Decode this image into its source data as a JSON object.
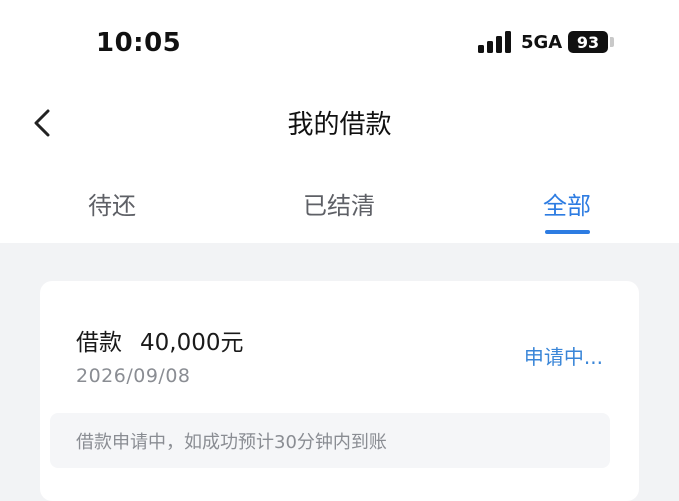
{
  "status_bar": {
    "time": "10:05",
    "network": "5GA",
    "battery": "93"
  },
  "header": {
    "title": "我的借款",
    "back_icon": "chevron-left-icon"
  },
  "tabs": [
    {
      "label": "待还"
    },
    {
      "label": "已结清"
    },
    {
      "label": "全部"
    }
  ],
  "active_tab": "全部",
  "loan": {
    "label": "借款",
    "amount": "40,000元",
    "date": "2026/09/08",
    "status": "申请中...",
    "notice": "借款申请中，如成功预计30分钟内到账"
  },
  "colors": {
    "accent": "#2d7ce2",
    "background": "#f2f3f5",
    "card": "#ffffff"
  }
}
